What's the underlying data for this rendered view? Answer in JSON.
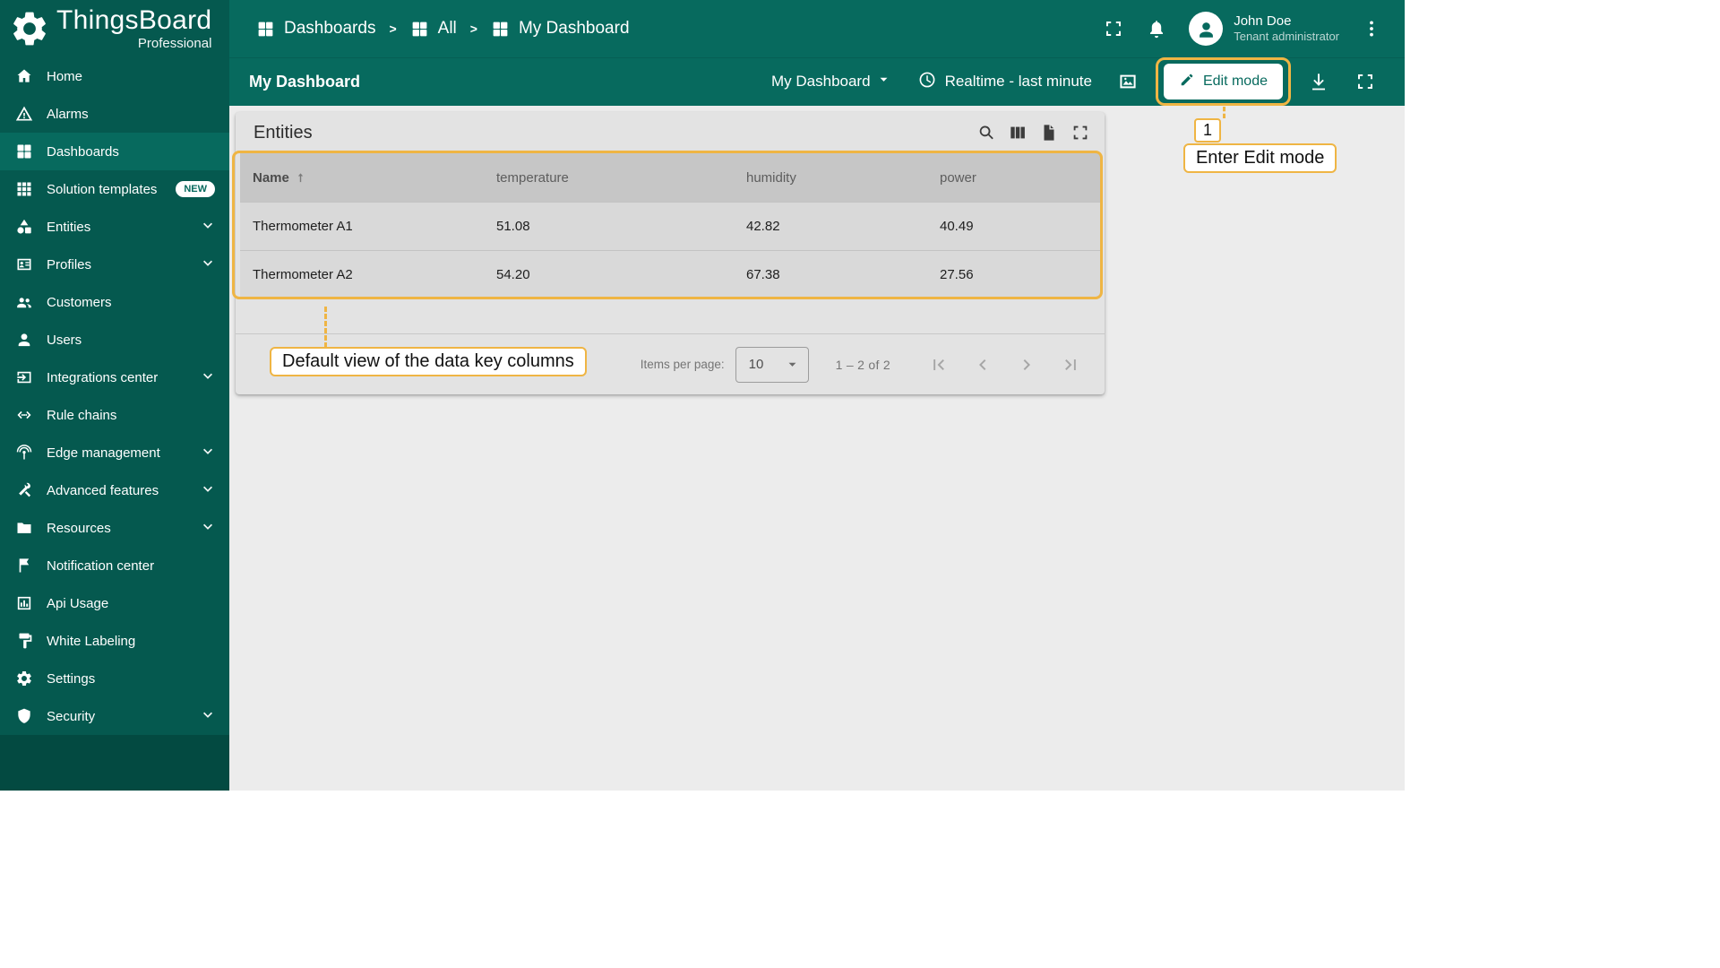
{
  "colors": {
    "teal_header": "#076a5e",
    "teal_sidebar": "#05594f",
    "teal_sidebar_bottom": "#034a41",
    "teal_active": "#076a5e",
    "page_bg": "#ececec",
    "card_bg": "#e3e3e3",
    "table_header_bg": "#c6c6c6",
    "table_row_bg": "#d9d9d9",
    "annotation": "#efb544"
  },
  "brand": {
    "name": "ThingsBoard",
    "subtitle": "Professional"
  },
  "header": {
    "breadcrumb": [
      "Dashboards",
      "All",
      "My Dashboard"
    ],
    "icons": [
      "fullscreen-icon",
      "bell-icon",
      "kebab-icon"
    ],
    "user": {
      "name": "John Doe",
      "role": "Tenant administrator"
    }
  },
  "toolbar": {
    "title": "My Dashboard",
    "dashboard_select": "My Dashboard",
    "timewindow": "Realtime - last minute",
    "edit_button": "Edit mode",
    "icons": [
      "image-icon",
      "download-icon",
      "fullscreen-icon"
    ]
  },
  "sidebar": [
    {
      "label": "Home",
      "icon": "home-icon"
    },
    {
      "label": "Alarms",
      "icon": "alarm-icon"
    },
    {
      "label": "Dashboards",
      "icon": "dashboards-icon",
      "active": true
    },
    {
      "label": "Solution templates",
      "icon": "solution-templates-icon",
      "badge": "NEW"
    },
    {
      "label": "Entities",
      "icon": "entities-icon",
      "expandable": true
    },
    {
      "label": "Profiles",
      "icon": "profiles-icon",
      "expandable": true
    },
    {
      "label": "Customers",
      "icon": "customers-icon"
    },
    {
      "label": "Users",
      "icon": "users-icon"
    },
    {
      "label": "Integrations center",
      "icon": "integrations-icon",
      "expandable": true
    },
    {
      "label": "Rule chains",
      "icon": "rule-chains-icon"
    },
    {
      "label": "Edge management",
      "icon": "edge-icon",
      "expandable": true
    },
    {
      "label": "Advanced features",
      "icon": "advanced-icon",
      "expandable": true
    },
    {
      "label": "Resources",
      "icon": "resources-icon",
      "expandable": true
    },
    {
      "label": "Notification center",
      "icon": "notification-icon"
    },
    {
      "label": "Api Usage",
      "icon": "api-usage-icon"
    },
    {
      "label": "White Labeling",
      "icon": "white-labeling-icon"
    },
    {
      "label": "Settings",
      "icon": "settings-icon"
    },
    {
      "label": "Security",
      "icon": "security-icon",
      "expandable": true
    }
  ],
  "widget": {
    "title": "Entities",
    "action_icons": [
      "search-icon",
      "columns-icon",
      "export-icon",
      "fullscreen-icon"
    ],
    "columns": [
      "Name",
      "temperature",
      "humidity",
      "power"
    ],
    "sort_column": "Name",
    "sort_direction": "asc",
    "rows": [
      [
        "Thermometer A1",
        "51.08",
        "42.82",
        "40.49"
      ],
      [
        "Thermometer A2",
        "54.20",
        "67.38",
        "27.56"
      ]
    ],
    "pagination": {
      "items_per_page_label": "Items per page:",
      "page_size": "10",
      "range_label": "1 – 2 of 2",
      "pager_icons": [
        "pager-first-icon",
        "pager-prev-icon",
        "pager-next-icon",
        "pager-last-icon"
      ]
    }
  },
  "annotations": {
    "step": "1",
    "edit_label": "Enter Edit mode",
    "table_label": "Default view of the data key columns"
  }
}
